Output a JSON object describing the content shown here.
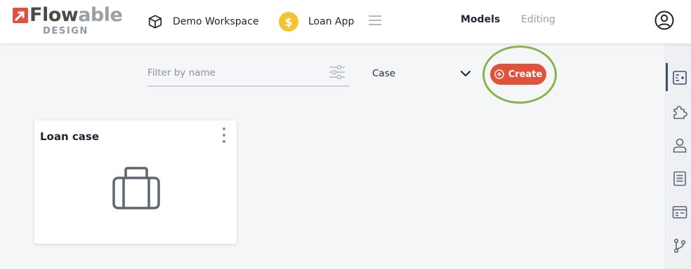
{
  "brand": {
    "wordmark_main": "Flow",
    "wordmark_tail": "able",
    "sub": "DESIGN",
    "accent_color": "#e0533a"
  },
  "header": {
    "workspace": {
      "icon": "cube-icon",
      "label": "Demo Workspace"
    },
    "app": {
      "icon": "dollar-coin-icon",
      "symbol": "$",
      "label": "Loan App"
    },
    "menu_icon": "hamburger-icon",
    "tabs": [
      {
        "label": "Models",
        "active": true
      },
      {
        "label": "Editing",
        "active": false
      }
    ],
    "profile_icon": "user-circle-icon"
  },
  "toolbar": {
    "filter_placeholder": "Filter by name",
    "filter_value": "",
    "filter_icon": "sliders-icon",
    "model_type_selected": "Case",
    "create_label": "Create",
    "create_icon": "plus-circle-icon",
    "highlight_color": "#8ab34a"
  },
  "models": [
    {
      "title": "Loan case",
      "icon": "briefcase-icon",
      "menu_icon": "kebab-menu-icon"
    }
  ],
  "rightbar": {
    "items": [
      {
        "icon": "model-editor-icon",
        "active": true
      },
      {
        "icon": "puzzle-icon",
        "active": false
      },
      {
        "icon": "user-icon",
        "active": false
      },
      {
        "icon": "document-icon",
        "active": false
      },
      {
        "icon": "form-icon",
        "active": false
      },
      {
        "icon": "git-branch-icon",
        "active": false
      }
    ]
  }
}
